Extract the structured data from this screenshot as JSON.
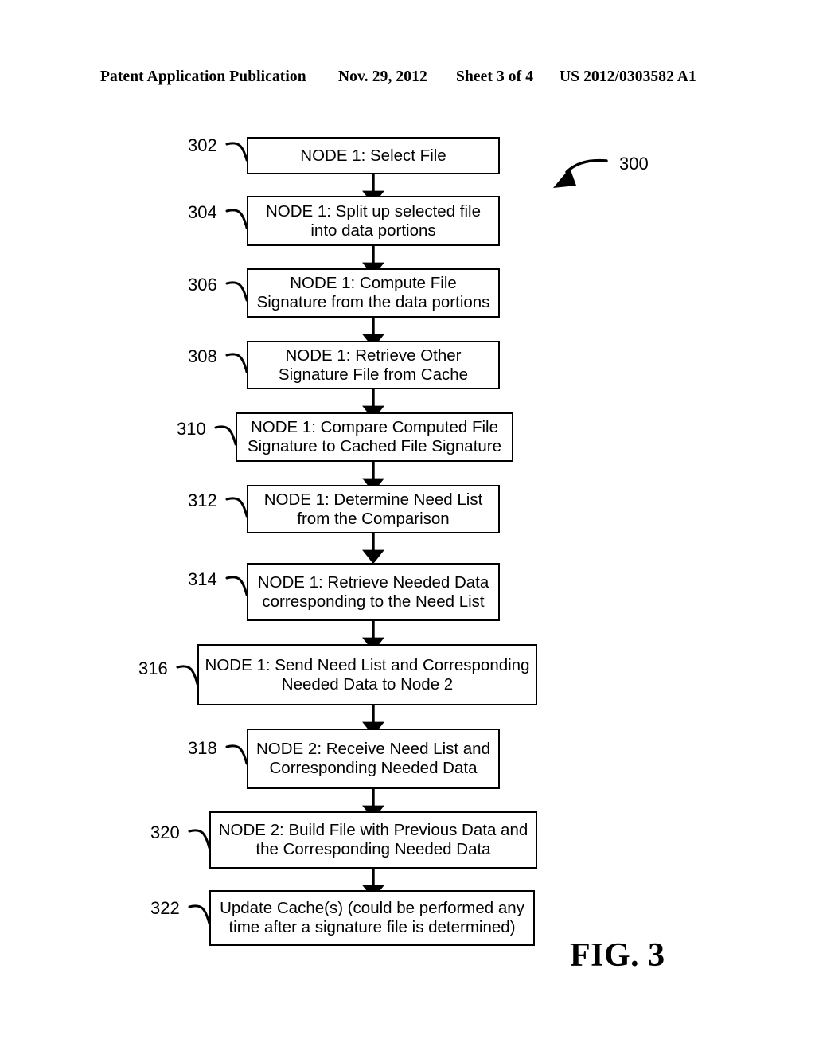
{
  "header": {
    "publication": "Patent Application Publication",
    "date": "Nov. 29, 2012",
    "sheet": "Sheet 3 of 4",
    "patent_number": "US 2012/0303582 A1"
  },
  "figure": {
    "caption": "FIG. 3",
    "diagram_ref": "300"
  },
  "flowchart": {
    "type": "flowchart",
    "orientation": "vertical",
    "steps": [
      {
        "ref": "302",
        "text": "NODE 1: Select File"
      },
      {
        "ref": "304",
        "text": "NODE 1: Split up selected file into data portions"
      },
      {
        "ref": "306",
        "text": "NODE 1: Compute File Signature from the data portions"
      },
      {
        "ref": "308",
        "text": "NODE 1: Retrieve Other Signature File from Cache"
      },
      {
        "ref": "310",
        "text": "NODE 1: Compare Computed File Signature to Cached File Signature"
      },
      {
        "ref": "312",
        "text": "NODE 1: Determine Need List from the Comparison"
      },
      {
        "ref": "314",
        "text": "NODE 1: Retrieve Needed Data corresponding to the Need List"
      },
      {
        "ref": "316",
        "text": "NODE 1: Send Need List and Corresponding Needed Data to Node 2"
      },
      {
        "ref": "318",
        "text": "NODE 2: Receive Need List and Corresponding Needed Data"
      },
      {
        "ref": "320",
        "text": "NODE 2: Build File with Previous Data and the Corresponding Needed Data"
      },
      {
        "ref": "322",
        "text": "Update Cache(s) (could be performed any time after a signature file is determined)"
      }
    ]
  }
}
